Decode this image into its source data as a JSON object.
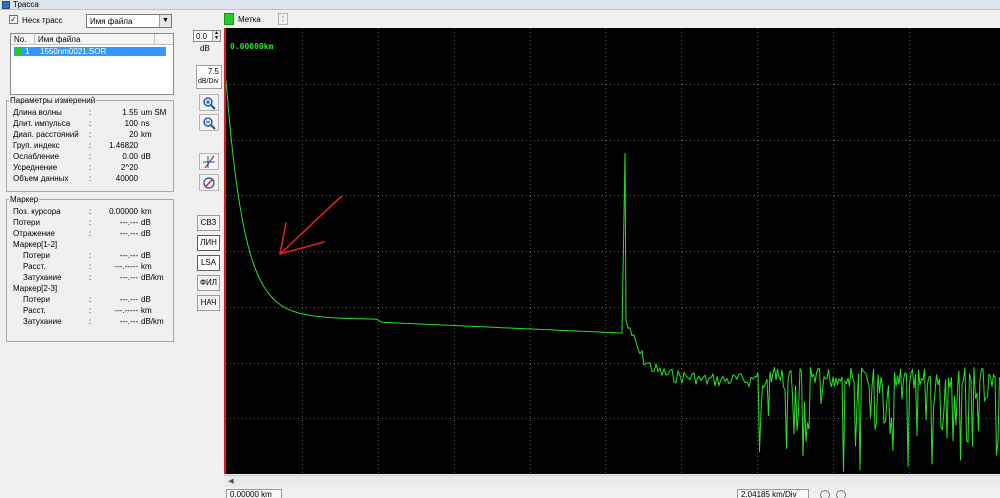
{
  "window": {
    "title": "Трасса"
  },
  "trace_filter": {
    "checkbox_label": "Неск трасс",
    "checked": true,
    "mode_value": "Имя файла"
  },
  "file_list": {
    "columns": [
      "No.",
      "Имя файла"
    ],
    "rows": [
      {
        "no": "1",
        "name": "1550nm0021.SOR",
        "color": "#22cc22"
      }
    ]
  },
  "measurement": {
    "title": "Параметры измерений",
    "rows": [
      {
        "label": "Длина волны",
        "value": "1.55",
        "unit": "um SM"
      },
      {
        "label": "Длит. импульса",
        "value": "100",
        "unit": "ns"
      },
      {
        "label": "Диап. расстояний",
        "value": "20",
        "unit": "km"
      },
      {
        "label": "Груп. индекс",
        "value": "1.46820",
        "unit": ""
      },
      {
        "label": "Ослабление",
        "value": "0.00",
        "unit": "dB"
      },
      {
        "label": "Усреднение",
        "value": "2^20",
        "unit": ""
      },
      {
        "label": "Объем данных",
        "value": "40000",
        "unit": ""
      }
    ]
  },
  "marker": {
    "title": "Маркер",
    "rows": [
      {
        "label": "Поз. курсора",
        "value": "0.00000",
        "unit": "km"
      },
      {
        "label": "Потери",
        "value": "---.---",
        "unit": "dB"
      },
      {
        "label": "Отражение",
        "value": "---.---",
        "unit": "dB"
      },
      {
        "label": "Маркер[1-2]",
        "value": "",
        "unit": ""
      },
      {
        "label": "Потери",
        "value": "---.---",
        "unit": "dB"
      },
      {
        "label": "Расст.",
        "value": "---.-----",
        "unit": "km"
      },
      {
        "label": "Затухание",
        "value": "---.---",
        "unit": "dB/km"
      },
      {
        "label": "Маркер[2-3]",
        "value": "",
        "unit": ""
      },
      {
        "label": "Потери",
        "value": "---.---",
        "unit": "dB"
      },
      {
        "label": "Расст.",
        "value": "---.-----",
        "unit": "km"
      },
      {
        "label": "Затухание",
        "value": "---.---",
        "unit": "dB/km"
      }
    ]
  },
  "toolbar": {
    "offset_value": "0.0",
    "offset_unit": "dB",
    "scale_value": "7.5",
    "scale_unit": "dB/Div",
    "modes": [
      "СВЗ",
      "ЛИН",
      "LSA",
      "ФИЛ",
      "НАЧ"
    ],
    "active_modes": [
      "ЛИН",
      "LSA"
    ],
    "icons": [
      "zoom-in-icon",
      "zoom-fit-icon",
      "marker-cursor-icon",
      "marker-clear-icon"
    ]
  },
  "graph": {
    "marker_label": "Метка",
    "marker_colon": ":",
    "distance_readout": "0.00000km",
    "trace_color": "#22e622",
    "border_color": "#e01818",
    "annotation_color": "#e02020",
    "bottom_left": "0.00000 km",
    "bottom_right": "2.04185 km/Div"
  }
}
